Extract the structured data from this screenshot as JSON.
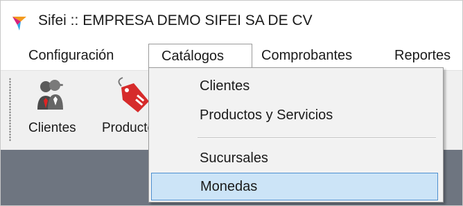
{
  "window": {
    "title": "Sifei :: EMPRESA DEMO SIFEI SA DE CV",
    "logo_icon": "sifei-logo-icon"
  },
  "menubar": {
    "items": [
      {
        "label": "Configuración",
        "open": false
      },
      {
        "label": "Catálogos",
        "open": true
      },
      {
        "label": "Comprobantes",
        "open": false
      },
      {
        "label": "Reportes",
        "open": false
      }
    ]
  },
  "toolbar": {
    "items": [
      {
        "label": "Clientes",
        "icon": "clients-icon"
      },
      {
        "label": "Productos y Servicios",
        "icon": "product-tag-icon"
      }
    ]
  },
  "dropdown": {
    "items": [
      {
        "label": "Clientes",
        "highlighted": false
      },
      {
        "label": "Productos y Servicios",
        "highlighted": false
      },
      {
        "label": "Sucursales",
        "highlighted": false
      },
      {
        "label": "Monedas",
        "highlighted": true
      }
    ]
  },
  "colors": {
    "accent_logo_blue": "#2aa8e8",
    "accent_logo_magenta": "#d4237c",
    "accent_logo_orange": "#f39a1e",
    "hover_background": "#cce4f7",
    "hover_border": "#4d8fcf",
    "workarea_background": "#6e7580"
  }
}
